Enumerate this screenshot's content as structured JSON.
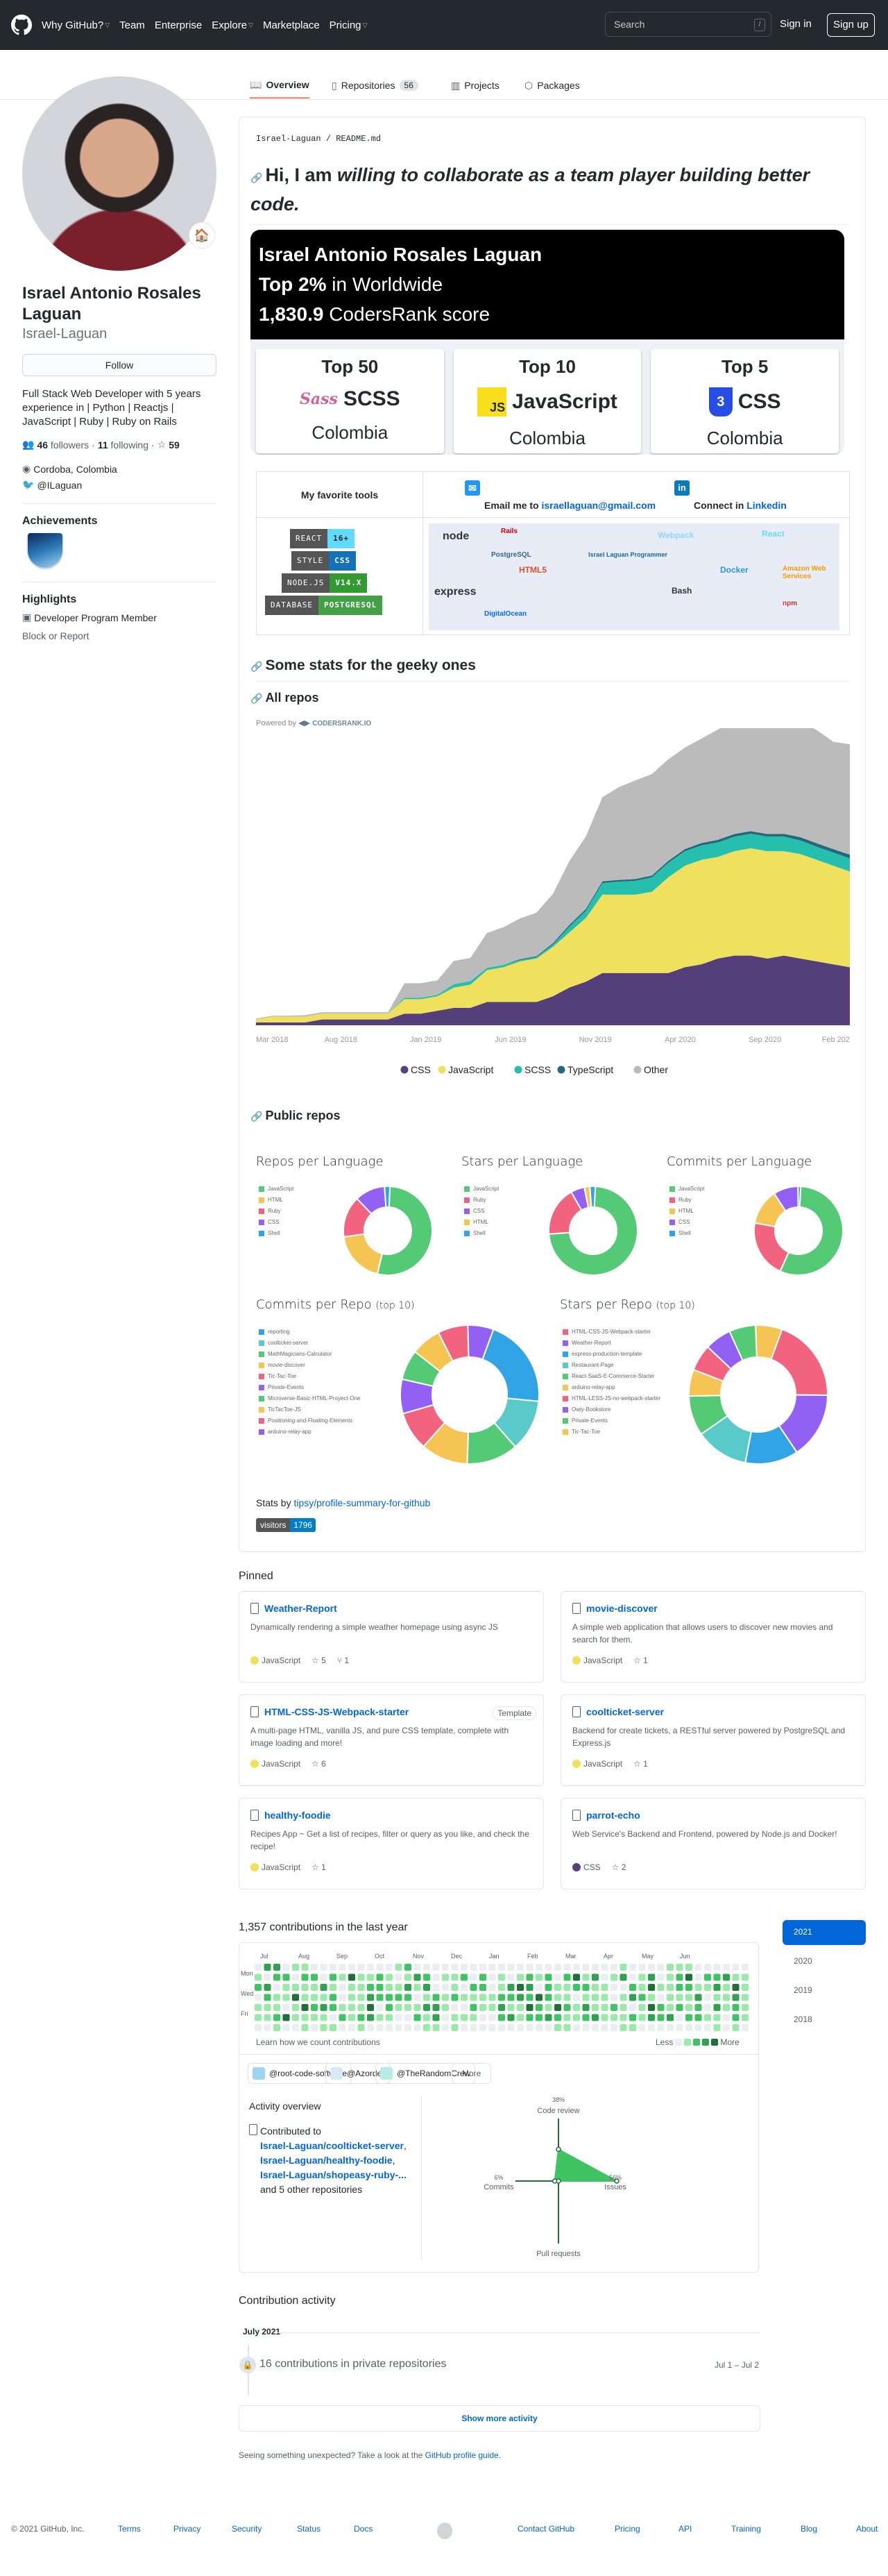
{
  "header": {
    "nav": [
      {
        "label": "Why GitHub?",
        "dropdown": true
      },
      {
        "label": "Team",
        "dropdown": false
      },
      {
        "label": "Enterprise",
        "dropdown": false
      },
      {
        "label": "Explore",
        "dropdown": true
      },
      {
        "label": "Marketplace",
        "dropdown": false
      },
      {
        "label": "Pricing",
        "dropdown": true
      }
    ],
    "search_placeholder": "Search",
    "search_shortcut": "/",
    "sign_in": "Sign in",
    "sign_up": "Sign up"
  },
  "tabs": [
    {
      "label": "Overview",
      "icon": "book-icon",
      "selected": true
    },
    {
      "label": "Repositories",
      "icon": "repo-icon",
      "count": "56"
    },
    {
      "label": "Projects",
      "icon": "project-icon"
    },
    {
      "label": "Packages",
      "icon": "package-icon"
    }
  ],
  "profile": {
    "status_emoji": "🏠",
    "name": "Israel Antonio Rosales Laguan",
    "login": "Israel-Laguan",
    "follow_label": "Follow",
    "bio": "Full Stack Web Developer with 5 years experience in | Python | Reactjs | JavaScript | Ruby | Ruby on Rails",
    "followers": "46",
    "followers_label": "followers",
    "following": "11",
    "following_label": "following",
    "stars": "59",
    "location": "Cordoba, Colombia",
    "twitter": "@ILaguan",
    "achievements_title": "Achievements",
    "highlights_title": "Highlights",
    "highlight": "Developer Program Member",
    "block_report": "Block or Report"
  },
  "readme": {
    "path_user": "Israel-Laguan",
    "path_sep": " / ",
    "path_file": "README.md",
    "heading_plain": "Hi, I am ",
    "heading_em": "willing to collaborate as a team player building better code.",
    "codersrank": {
      "name": "Israel Antonio Rosales Laguan",
      "rank_bold": "Top 2%",
      "rank_rest": " in Worldwide",
      "score_bold": "1,830.9",
      "score_rest": " CodersRank score",
      "cards": [
        {
          "top": "Top 50",
          "lang": "SCSS",
          "place": "Colombia",
          "logo": "sass-logo"
        },
        {
          "top": "Top 10",
          "lang": "JavaScript",
          "place": "Colombia",
          "logo": "js-logo"
        },
        {
          "top": "Top 5",
          "lang": "CSS",
          "place": "Colombia",
          "logo": "css3-logo"
        }
      ]
    },
    "table": {
      "tools_title": "My favorite tools",
      "email_prefix": "Email me to ",
      "email": "israellaguan@gmail.com",
      "linkedin_prefix": "Connect in ",
      "linkedin": "Linkedin",
      "badges": [
        {
          "left": "REACT",
          "right": "16+",
          "right_color": "#61dafb",
          "right_text": "#222"
        },
        {
          "left": "STYLE",
          "right": "CSS",
          "right_color": "#1572b6",
          "right_text": "#fff"
        },
        {
          "left": "NODE.JS",
          "right": "V14.X",
          "right_color": "#339933",
          "right_text": "#fff"
        },
        {
          "left": "DATABASE",
          "right": "POSTGRESQL",
          "right_color": "#43a047",
          "right_text": "#fff"
        }
      ],
      "tech_logos": [
        "node",
        "Rails",
        "PostgreSQL",
        "HTML5",
        "express",
        "Israel Laguan Programmer",
        "Webpack",
        "React",
        "Docker",
        "Amazon Web Services",
        "Bash",
        "npm",
        "DigitalOcean"
      ]
    },
    "stats_heading": "Some stats for the geeky ones",
    "all_repos_heading": "All repos",
    "powered_by": "Powered by",
    "powered_brand": "CODERSRANK.IO",
    "public_repos_heading": "Public repos",
    "stats_by_prefix": "Stats by ",
    "stats_by_link": "tipsy/profile-summary-for-github",
    "visitors_label": "visitors",
    "visitors_count": "1796"
  },
  "chart_data": [
    {
      "type": "area",
      "title": "All repos",
      "stacked": true,
      "x_ticks": [
        "Mar 2018",
        "Aug 2018",
        "Jan 2019",
        "Jun 2019",
        "Nov 2019",
        "Apr 2020",
        "Sep 2020",
        "Feb 202"
      ],
      "x_points": 37,
      "ylim": [
        0,
        100
      ],
      "legend_position": "bottom",
      "series": [
        {
          "name": "CSS",
          "color": "#553f7a",
          "values": [
            1,
            1,
            1,
            1,
            2,
            2,
            2,
            2,
            2,
            4,
            4,
            5,
            6,
            6,
            8,
            8,
            8,
            8,
            10,
            13,
            15,
            18,
            18,
            18,
            18,
            18,
            20,
            21,
            23,
            24,
            24,
            23,
            24,
            23,
            22,
            21,
            20
          ]
        },
        {
          "name": "JavaScript",
          "color": "#efe05e",
          "values": [
            1,
            2,
            2,
            2,
            2,
            2,
            2,
            2,
            2,
            5,
            5,
            5,
            7,
            8,
            11,
            12,
            14,
            15,
            17,
            19,
            22,
            27,
            27,
            27,
            28,
            33,
            35,
            36,
            35,
            36,
            37,
            37,
            36,
            36,
            35,
            34,
            33
          ]
        },
        {
          "name": "SCSS",
          "color": "#26bfad",
          "values": [
            0,
            0,
            0,
            0,
            0,
            0,
            0,
            0,
            0,
            0.5,
            0.5,
            0.5,
            1.2,
            1.2,
            0.8,
            0.8,
            0.5,
            0.5,
            0.8,
            2,
            2.5,
            4,
            4.5,
            4.8,
            5,
            5,
            5,
            5,
            5,
            5,
            5,
            5,
            5,
            4.7,
            4.5,
            4.5,
            4.5
          ]
        },
        {
          "name": "TypeScript",
          "color": "#216a7e",
          "values": [
            0,
            0,
            0,
            0,
            0,
            0,
            0,
            0,
            0,
            0,
            0,
            0,
            0,
            0,
            0,
            0,
            0.3,
            0.3,
            0.5,
            0.6,
            0.6,
            0.6,
            0.6,
            0.6,
            0.6,
            0.7,
            0.7,
            0.8,
            0.9,
            0.9,
            0.9,
            0.9,
            1,
            1.1,
            1.2,
            1.2,
            1.3
          ]
        },
        {
          "name": "Other",
          "color": "#bbbbbb",
          "values": [
            0.3,
            0.3,
            0.3,
            0.5,
            0.5,
            0.5,
            0.5,
            0.5,
            0.5,
            5,
            5,
            5,
            8,
            8,
            12,
            13,
            14,
            15,
            17,
            22,
            25,
            29,
            32,
            34,
            35,
            35,
            35,
            36,
            38,
            40,
            40,
            40,
            39,
            40,
            39,
            37,
            38
          ]
        }
      ]
    },
    {
      "type": "pie",
      "title": "Repos per Language",
      "labels": [
        "JavaScript",
        "HTML",
        "Ruby",
        "CSS",
        "Shell"
      ],
      "values": [
        53,
        19,
        15,
        11,
        2
      ],
      "colors": [
        "#54ca76",
        "#f5c452",
        "#f2637f",
        "#9261f3",
        "#31a4e6"
      ]
    },
    {
      "type": "pie",
      "title": "Stars per Language",
      "labels": [
        "JavaScript",
        "Ruby",
        "CSS",
        "HTML",
        "Shell"
      ],
      "values": [
        73,
        18,
        5,
        2,
        2
      ],
      "colors": [
        "#54ca76",
        "#f2637f",
        "#9261f3",
        "#f5c452",
        "#31a4e6"
      ]
    },
    {
      "type": "pie",
      "title": "Commits per Language",
      "labels": [
        "JavaScript",
        "Ruby",
        "HTML",
        "CSS",
        "Shell"
      ],
      "values": [
        56,
        21,
        13,
        9,
        1
      ],
      "colors": [
        "#54ca76",
        "#f2637f",
        "#f5c452",
        "#9261f3",
        "#31a4e6"
      ]
    },
    {
      "type": "pie",
      "title": "Commits per Repo",
      "subtitle": "(top 10)",
      "labels": [
        "reporting",
        "coolticket-server",
        "MathMagicians-Calculator",
        "movie-discover",
        "Tic-Tac-Toe",
        "Private-Events",
        "Microverse-Basic-HTML-Proyect-One",
        "TicTacToe-JS",
        "Positioning-and-Floating-Elements",
        "arduino-relay-app"
      ],
      "values": [
        21,
        12,
        12,
        11,
        9,
        8,
        7,
        7,
        7,
        6
      ],
      "colors": [
        "#31a4e6",
        "#5ac9c9",
        "#54ca76",
        "#f5c452",
        "#f2637f",
        "#9261f3",
        "#54ca76",
        "#f5c452",
        "#f2637f",
        "#9261f3"
      ]
    },
    {
      "type": "pie",
      "title": "Stars per Repo",
      "subtitle": "(top 10)",
      "labels": [
        "HTML-CSS-JS-Webpack-starter",
        "Weather-Report",
        "express-production-template",
        "Restaurant-Page",
        "React-SaaS-E-Commerce-Starter",
        "arduino-relay-app",
        "HTML-LESS-JS-no-webpack-starter",
        "Owly-Bookstore",
        "Private-Events",
        "Tic-Tac-Toe"
      ],
      "values": [
        19,
        15,
        12,
        12,
        9,
        6,
        6,
        6,
        6,
        6
      ],
      "colors": [
        "#f2637f",
        "#9261f3",
        "#31a4e6",
        "#5ac9c9",
        "#54ca76",
        "#f5c452",
        "#f2637f",
        "#9261f3",
        "#54ca76",
        "#f5c452"
      ]
    },
    {
      "type": "radar",
      "title": "Activity overview",
      "axes": [
        "Code review",
        "Issues",
        "Pull requests",
        "Commits"
      ],
      "values": [
        38,
        56,
        0,
        6
      ],
      "labels": [
        "38%",
        "56%",
        "",
        "6%"
      ]
    }
  ],
  "pinned": {
    "title": "Pinned",
    "repos": [
      {
        "name": "Weather-Report",
        "desc": "Dynamically rendering a simple weather homepage using async JS",
        "lang": "JavaScript",
        "lang_color": "#f1e05a",
        "stars": "5",
        "forks": "1"
      },
      {
        "name": "movie-discover",
        "desc": "A simple web application that allows users to discover new movies and search for them.",
        "lang": "JavaScript",
        "lang_color": "#f1e05a",
        "stars": "1"
      },
      {
        "name": "HTML-CSS-JS-Webpack-starter",
        "desc": "A multi-page HTML, vanilla JS, and pure CSS template, complete with image loading and more!",
        "lang": "JavaScript",
        "lang_color": "#f1e05a",
        "stars": "6",
        "badge": "Template"
      },
      {
        "name": "coolticket-server",
        "desc": "Backend for create tickets, a RESTful server powered by PostgreSQL and Express.js",
        "lang": "JavaScript",
        "lang_color": "#f1e05a",
        "stars": "1"
      },
      {
        "name": "healthy-foodie",
        "desc": "Recipes App ~ Get a list of recipes, filter or query as you like, and check the recipe!",
        "lang": "JavaScript",
        "lang_color": "#f1e05a",
        "stars": "1"
      },
      {
        "name": "parrot-echo",
        "desc": "Web Service's Backend and Frontend, powered by Node.js and Docker!",
        "lang": "CSS",
        "lang_color": "#563d7c",
        "stars": "2"
      }
    ]
  },
  "contributions": {
    "title": "1,357 contributions in the last year",
    "months": [
      "Jul",
      "Aug",
      "Sep",
      "Oct",
      "Nov",
      "Dec",
      "Jan",
      "Feb",
      "Mar",
      "Apr",
      "May",
      "Jun"
    ],
    "days": [
      "Mon",
      "Wed",
      "Fri"
    ],
    "learn_link": "Learn how we count contributions",
    "less": "Less",
    "more": "More",
    "level_colors": [
      "#ebedf0",
      "#9be9a8",
      "#40c463",
      "#30a14e",
      "#216e39"
    ],
    "years": [
      {
        "label": "2021",
        "selected": true
      },
      {
        "label": "2020"
      },
      {
        "label": "2019"
      },
      {
        "label": "2018"
      }
    ],
    "orgs": [
      "@root-code-software",
      "@Azordev",
      "@TheRandomCrew"
    ],
    "orgs_more": "More",
    "activity_title": "Activity overview",
    "contributed_to": "Contributed to",
    "repos": [
      "Israel-Laguan/coolticket-server",
      "Israel-Laguan/healthy-foodie",
      "Israel-Laguan/shopeasy-ruby-..."
    ],
    "others": "and 5 other repositories",
    "radar": {
      "code_review_pct": "38%",
      "code_review": "Code review",
      "issues_pct": "56%",
      "issues": "Issues",
      "commits_pct": "6%",
      "commits": "Commits",
      "pull_requests": "Pull requests"
    }
  },
  "activity": {
    "title": "Contribution activity",
    "month": "July 2021",
    "item": "16 contributions in private repositories",
    "range": "Jul 1 – Jul 2",
    "show_more": "Show more activity",
    "guide_prefix": "Seeing something unexpected? Take a look at the ",
    "guide_link": "GitHub profile guide",
    "guide_suffix": "."
  },
  "footer": {
    "copyright": "© 2021 GitHub, Inc.",
    "left_links": [
      "Terms",
      "Privacy",
      "Security",
      "Status",
      "Docs"
    ],
    "right_links": [
      "Contact GitHub",
      "Pricing",
      "API",
      "Training",
      "Blog",
      "About"
    ]
  }
}
